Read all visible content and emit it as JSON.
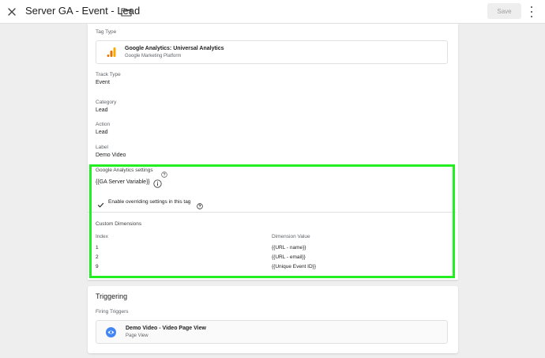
{
  "header": {
    "title": "Server GA - Event - Lead",
    "save_label": "Save"
  },
  "tag_config": {
    "tag_type_label": "Tag Type",
    "tag_type_name": "Google Analytics: Universal Analytics",
    "tag_type_vendor": "Google Marketing Platform",
    "track_type_label": "Track Type",
    "track_type_value": "Event",
    "category_label": "Category",
    "category_value": "Lead",
    "action_label": "Action",
    "action_value": "Lead",
    "event_label_label": "Label",
    "event_label_value": "Demo Video",
    "ga_settings_label": "Google Analytics settings",
    "ga_settings_value": "{{GA Server Variable}}",
    "override_label": "Enable overriding settings in this tag",
    "custom_dimensions_label": "Custom Dimensions",
    "index_header": "Index",
    "dimension_value_header": "Dimension Value",
    "dimensions": [
      {
        "index": "1",
        "value": "{{URL - name}}"
      },
      {
        "index": "2",
        "value": "{{URL - email}}"
      },
      {
        "index": "9",
        "value": "{{Unique Event ID}}"
      }
    ]
  },
  "triggering": {
    "title": "Triggering",
    "firing_label": "Firing Triggers",
    "trigger_name": "Demo Video - Video Page View",
    "trigger_type": "Page View"
  },
  "colors": {
    "highlight": "#22ee22",
    "ga_orange": "#f9ab00",
    "trigger_blue": "#4285f4"
  },
  "icons": [
    "close-icon",
    "folder-icon",
    "more-vert-icon",
    "google-analytics-icon",
    "help-icon",
    "info-icon",
    "check-icon",
    "eye-icon"
  ]
}
